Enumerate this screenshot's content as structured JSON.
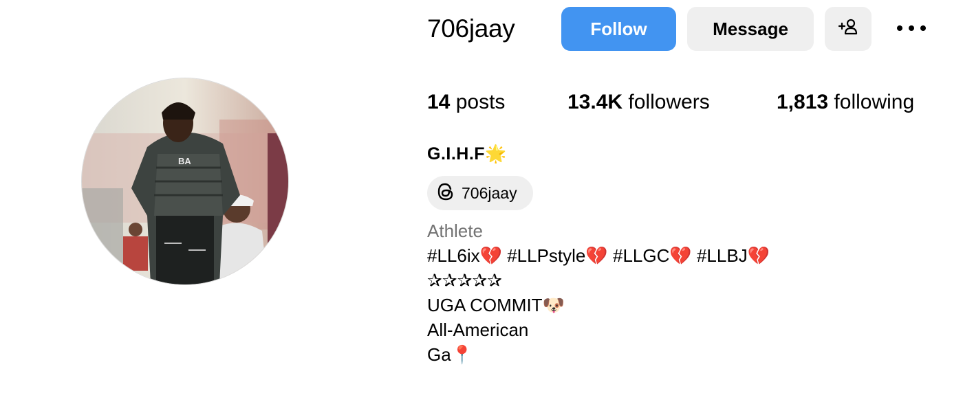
{
  "profile": {
    "username": "706jaay",
    "full_name": "G.I.H.F🌟",
    "threads_handle": "706jaay",
    "category": "Athlete"
  },
  "actions": {
    "follow_label": "Follow",
    "message_label": "Message",
    "add_user_icon": "add-user-icon",
    "more_icon": "more-options-icon"
  },
  "stats": {
    "posts_count": "14",
    "posts_label": "posts",
    "followers_count": "13.4K",
    "followers_label": "followers",
    "following_count": "1,813",
    "following_label": "following"
  },
  "bio": {
    "lines": [
      "#LL6ix💔 #LLPstyle💔 #LLGC💔 #LLBJ💔",
      "✰✰✰✰✰",
      "UGA COMMIT🐶",
      "All-American",
      "Ga📍"
    ]
  },
  "colors": {
    "follow_button": "#4294f1",
    "secondary_button": "#efefef",
    "category_text": "#737373"
  }
}
